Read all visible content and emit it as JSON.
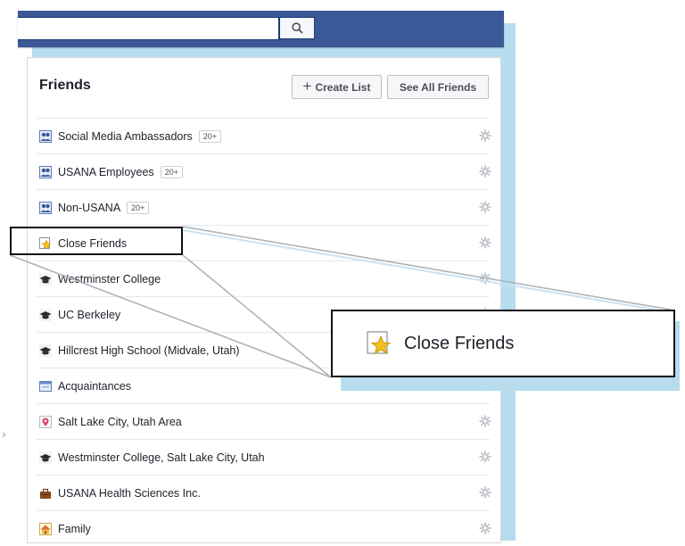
{
  "search": {
    "placeholder": ""
  },
  "panel": {
    "title": "Friends",
    "create_list_label": "Create List",
    "see_all_label": "See All Friends"
  },
  "lists": [
    {
      "label": "Social Media Ambassadors",
      "count": "20+",
      "icon": "group-icon"
    },
    {
      "label": "USANA Employees",
      "count": "20+",
      "icon": "group-icon"
    },
    {
      "label": "Non-USANA",
      "count": "20+",
      "icon": "group-icon"
    },
    {
      "label": "Close Friends",
      "count": "",
      "icon": "star-icon"
    },
    {
      "label": "Westminster College",
      "count": "",
      "icon": "graduation-cap-icon"
    },
    {
      "label": "UC Berkeley",
      "count": "",
      "icon": "graduation-cap-icon"
    },
    {
      "label": "Hillcrest High School (Midvale, Utah)",
      "count": "",
      "icon": "graduation-cap-icon"
    },
    {
      "label": "Acquaintances",
      "count": "",
      "icon": "acquaintances-icon"
    },
    {
      "label": "Salt Lake City, Utah Area",
      "count": "",
      "icon": "location-pin-icon"
    },
    {
      "label": "Westminster College, Salt Lake City, Utah",
      "count": "",
      "icon": "graduation-cap-icon"
    },
    {
      "label": "USANA Health Sciences Inc.",
      "count": "",
      "icon": "briefcase-icon"
    },
    {
      "label": "Family",
      "count": "",
      "icon": "house-icon"
    }
  ],
  "zoom": {
    "label": "Close Friends"
  },
  "colors": {
    "topbar": "#3b5998",
    "accent_backing": "#b6dcee"
  }
}
